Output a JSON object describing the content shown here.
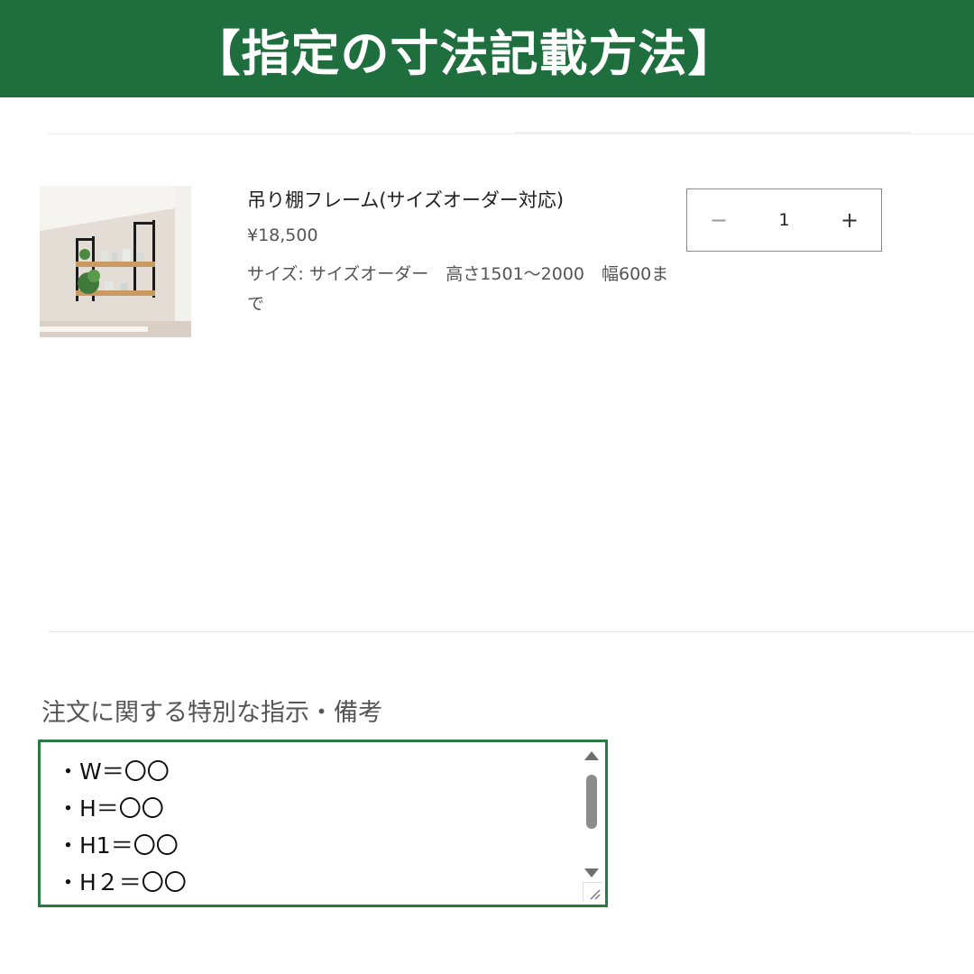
{
  "banner": {
    "title": "【指定の寸法記載方法】",
    "background": "#1f6f3e"
  },
  "product": {
    "name": "吊り棚フレーム(サイズオーダー対応)",
    "price": "¥18,500",
    "variant": "サイズ: サイズオーダー　高さ1501〜2000　幅600まで",
    "image_icon": "product-thumbnail"
  },
  "quantity": {
    "minus_label": "−",
    "value": "1",
    "plus_label": "+"
  },
  "note": {
    "label": "注文に関する特別な指示・備考",
    "lines": [
      "・W＝〇〇",
      "・H＝〇〇",
      "・H1＝〇〇",
      "・H２＝〇〇"
    ],
    "border_color": "#2a7a45"
  }
}
